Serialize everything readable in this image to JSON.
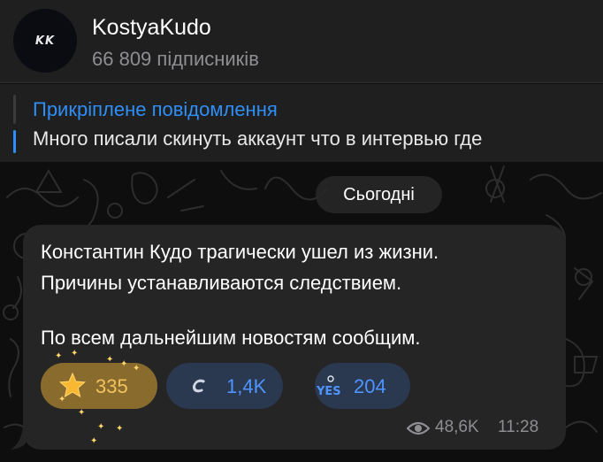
{
  "channel": {
    "title": "KostyaKudo",
    "subscribers": "66 809 підписників",
    "avatar_text": "KK"
  },
  "pinned": {
    "label": "Прикріплене повідомлення",
    "preview": "Много писали скинуть аккаунт что в интервью где"
  },
  "date_separator": "Сьогодні",
  "message": {
    "lines": [
      "Константин Кудо трагически ушел из жизни.",
      "Причины устанавливаются следствием.",
      "По всем дальнейшим новостям сообщим."
    ],
    "reactions": [
      {
        "icon": "star-icon",
        "count": "335"
      },
      {
        "icon": "c-sticker-icon",
        "count": "1,4K"
      },
      {
        "icon": "yes-icon",
        "count": "204"
      }
    ],
    "views": "48,6K",
    "time": "11:28"
  },
  "colors": {
    "accent": "#2f8ef7",
    "header_bg": "#1f1f1f",
    "bubble_bg": "#252525",
    "star_reaction_bg": "#8a6b2e",
    "reaction_bg": "#2a3850"
  }
}
